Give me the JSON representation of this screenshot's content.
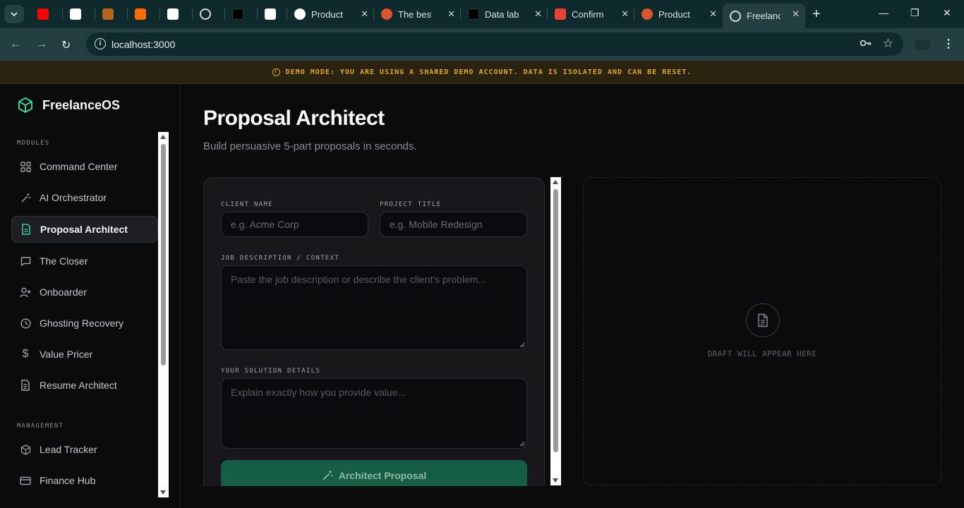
{
  "browser": {
    "tabs": [
      {
        "title": "",
        "favicon": "youtube-icon",
        "color": "#ff0000"
      },
      {
        "title": "",
        "favicon": "compass-icon",
        "color": "#ffffff"
      },
      {
        "title": "",
        "favicon": "avatar-icon",
        "color": "#b5651d"
      },
      {
        "title": "",
        "favicon": "chart-icon",
        "color": "#ff6a00"
      },
      {
        "title": "",
        "favicon": "w-icon",
        "color": "#ffffff"
      },
      {
        "title": "",
        "favicon": "globe-icon",
        "color": "#cfd8d8"
      },
      {
        "title": "",
        "favicon": "square-icon",
        "color": "#000000"
      },
      {
        "title": "",
        "favicon": "ih-icon",
        "color": "#ffffff"
      },
      {
        "title": "Product H",
        "favicon": "openai-icon",
        "color": "#ffffff"
      },
      {
        "title": "The best",
        "favicon": "producthunt-icon",
        "color": "#da552f"
      },
      {
        "title": "Data label",
        "favicon": "square-icon",
        "color": "#000000"
      },
      {
        "title": "Confirm y",
        "favicon": "gmail-icon",
        "color": "#ea4335"
      },
      {
        "title": "Product H",
        "favicon": "producthunt-icon",
        "color": "#da552f"
      },
      {
        "title": "Freelance",
        "favicon": "globe-icon",
        "color": "#cfd8d8"
      }
    ],
    "url": "localhost:3000"
  },
  "banner": {
    "text": "DEMO MODE: YOU ARE USING A SHARED DEMO ACCOUNT. DATA IS ISOLATED AND CAN BE RESET."
  },
  "sidebar": {
    "brand": "FreelanceOS",
    "modules_label": "MODULES",
    "modules": [
      {
        "label": "Command Center",
        "icon": "grid-icon"
      },
      {
        "label": "AI Orchestrator",
        "icon": "wand-icon"
      },
      {
        "label": "Proposal Architect",
        "icon": "document-icon",
        "active": true
      },
      {
        "label": "The Closer",
        "icon": "chat-icon"
      },
      {
        "label": "Onboarder",
        "icon": "user-plus-icon"
      },
      {
        "label": "Ghosting Recovery",
        "icon": "clock-icon"
      },
      {
        "label": "Value Pricer",
        "icon": "dollar-icon"
      },
      {
        "label": "Resume Architect",
        "icon": "file-text-icon"
      }
    ],
    "management_label": "MANAGEMENT",
    "management": [
      {
        "label": "Lead Tracker",
        "icon": "box-icon"
      },
      {
        "label": "Finance Hub",
        "icon": "card-icon"
      }
    ]
  },
  "main": {
    "title": "Proposal Architect",
    "subtitle": "Build persuasive 5-part proposals in seconds.",
    "form": {
      "client_name_label": "CLIENT NAME",
      "client_name_placeholder": "e.g. Acme Corp",
      "client_name_value": "",
      "project_title_label": "PROJECT TITLE",
      "project_title_placeholder": "e.g. Mobile Redesign",
      "project_title_value": "",
      "job_description_label": "JOB DESCRIPTION / CONTEXT",
      "job_description_placeholder": "Paste the job description or describe the client's problem...",
      "solution_label": "YOUR SOLUTION DETAILS",
      "solution_placeholder": "Explain exactly how you provide value...",
      "submit_label": "Architect Proposal"
    },
    "preview": {
      "placeholder": "DRAFT WILL APPEAR HERE"
    }
  },
  "colors": {
    "accent": "#34d399",
    "button": "#155e45",
    "banner_text": "#e1a52a"
  }
}
